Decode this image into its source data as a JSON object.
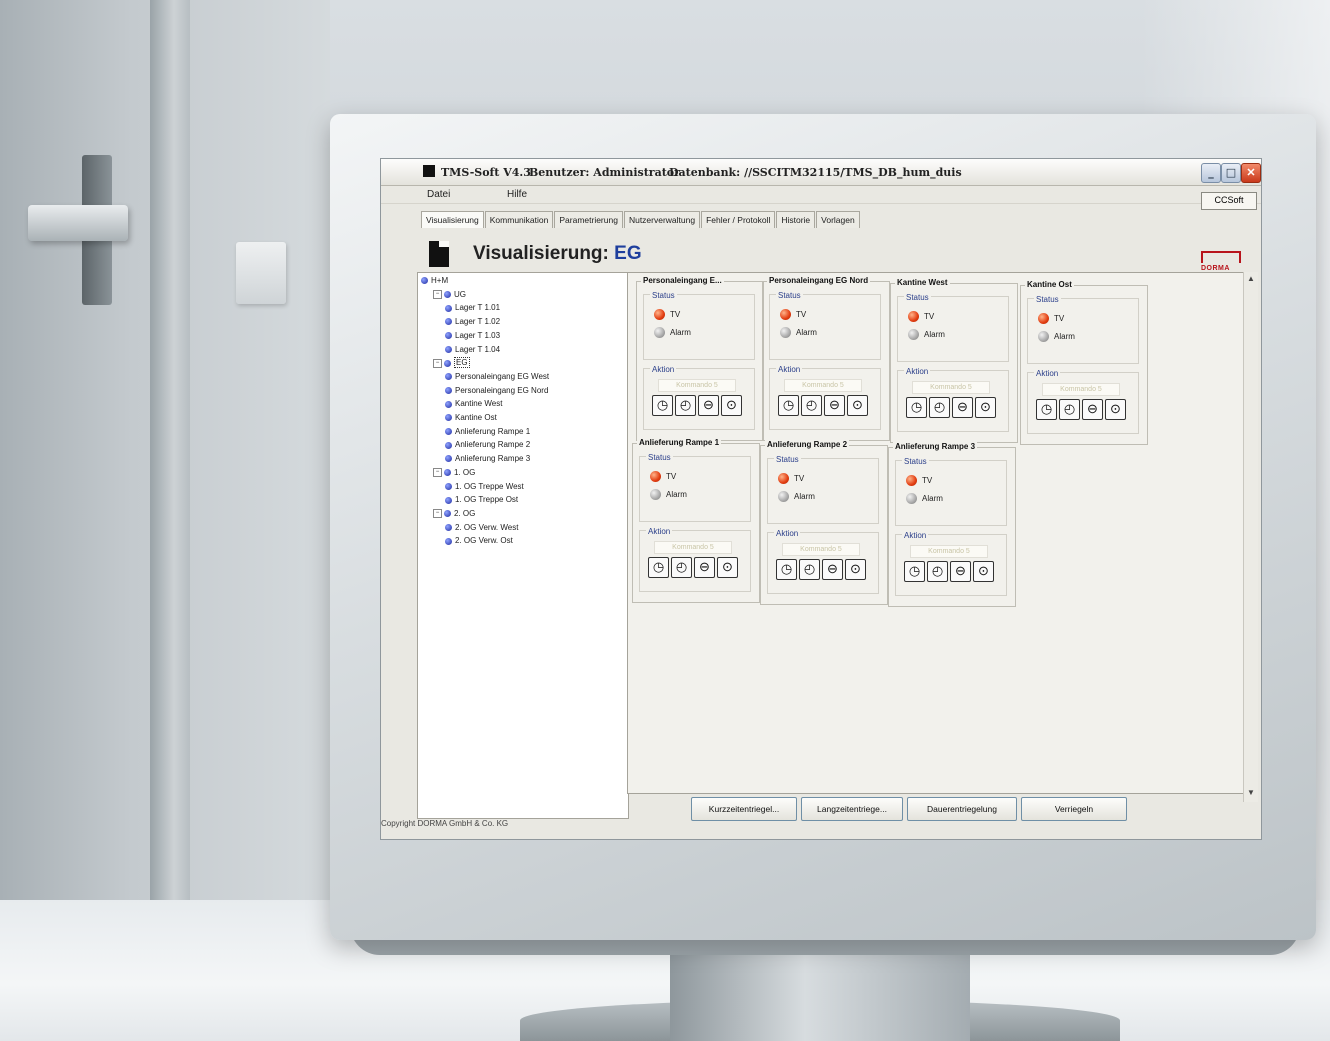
{
  "window": {
    "app_title": "TMS-Soft V4.3",
    "user": "Benutzer: Administrator",
    "database": "Datenbank: //SSCITM32115/TMS_DB_hum_duis",
    "minimize": "_",
    "maximize": "□",
    "close": "✕"
  },
  "menu": {
    "file": "Datei",
    "help": "Hilfe",
    "ccsoft": "CCSoft"
  },
  "tabs": [
    "Visualisierung",
    "Kommunikation",
    "Parametrierung",
    "Nutzerverwaltung",
    "Fehler / Protokoll",
    "Historie",
    "Vorlagen"
  ],
  "active_tab": "Visualisierung",
  "header": {
    "title": "Visualisierung:",
    "subtitle": "EG",
    "brand": "DORMA"
  },
  "tree": [
    "H+M",
    "UG",
    "Lager T 1.01",
    "Lager T 1.02",
    "Lager T 1.03",
    "Lager T 1.04",
    "EG",
    "Personaleingang EG West",
    "Personaleingang EG Nord",
    "Kantine West",
    "Kantine Ost",
    "Anlieferung Rampe 1",
    "Anlieferung Rampe 2",
    "Anlieferung Rampe 3",
    "1. OG",
    "1. OG Treppe West",
    "1. OG Treppe Ost",
    "2. OG",
    "2. OG Verw. West",
    "2. OG Verw. Ost"
  ],
  "labels": {
    "status": "Status",
    "action": "Aktion",
    "tv": "TV",
    "alarm": "Alarm",
    "command": "Kommando 5"
  },
  "doors": [
    {
      "name": "Personaleingang E...",
      "tv": "on",
      "alarm": "off"
    },
    {
      "name": "Personaleingang EG Nord",
      "tv": "on",
      "alarm": "off"
    },
    {
      "name": "Kantine West",
      "tv": "on",
      "alarm": "off"
    },
    {
      "name": "Kantine Ost",
      "tv": "on",
      "alarm": "off"
    },
    {
      "name": "Anlieferung Rampe 1",
      "tv": "on",
      "alarm": "off"
    },
    {
      "name": "Anlieferung Rampe 2",
      "tv": "on",
      "alarm": "off"
    },
    {
      "name": "Anlieferung Rampe 3",
      "tv": "on",
      "alarm": "off"
    }
  ],
  "action_icons": [
    "clock-icon",
    "clock-icon",
    "unlock-icon",
    "lock-icon"
  ],
  "buttons": {
    "short": "Kurzzeitentriegel...",
    "long": "Langzeitentriege...",
    "permanent": "Dauerentriegelung",
    "lock": "Verriegeln"
  },
  "footer": "Copyright DORMA GmbH & Co. KG",
  "colors": {
    "accent": "#1f3f9d",
    "brand": "#b8141c",
    "lamp_on": "#e23c10"
  }
}
